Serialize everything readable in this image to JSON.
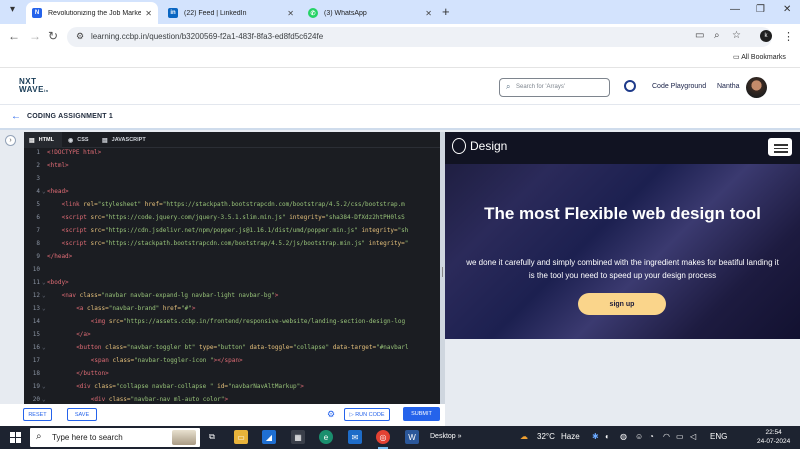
{
  "browser": {
    "tabs": [
      {
        "title": "Revolutionizing the Job Market",
        "favicon": "ccbp-icon",
        "color": "#2563eb",
        "active": true
      },
      {
        "title": "(22) Feed | LinkedIn",
        "favicon": "linkedin-icon",
        "color": "#0a66c2",
        "active": false
      },
      {
        "title": "(3) WhatsApp",
        "favicon": "whatsapp-icon",
        "color": "#25d366",
        "active": false
      }
    ],
    "url": "learning.ccbp.in/question/b3200569-f2a1-483f-8fa3-ed8fd5c624fe",
    "profile_initial": "k",
    "bookmarks_label": "All Bookmarks"
  },
  "site": {
    "logo_line1": "NXT",
    "logo_line2": "WAVE",
    "logo_suffix": "in",
    "search_placeholder": "Search for 'Arrays'",
    "playground_label": "Code Playground",
    "user_name": "Nantha",
    "assignment_title": "CODING ASSIGNMENT 1"
  },
  "editor": {
    "tabs": [
      {
        "label": "HTML",
        "icon": "html-file-icon",
        "active": true
      },
      {
        "label": "CSS",
        "icon": "css-file-icon",
        "active": false
      },
      {
        "label": "JAVASCRIPT",
        "icon": "js-file-icon",
        "active": false
      }
    ],
    "lines": [
      {
        "n": "1",
        "indent": 0,
        "fold": false,
        "segs": [
          [
            "tag",
            "<!DOCTYPE html>"
          ]
        ]
      },
      {
        "n": "2",
        "indent": 0,
        "fold": false,
        "segs": [
          [
            "tag",
            "<html>"
          ]
        ]
      },
      {
        "n": "3",
        "indent": 0,
        "fold": false,
        "segs": []
      },
      {
        "n": "4",
        "indent": 0,
        "fold": true,
        "segs": [
          [
            "tag",
            "<head>"
          ]
        ]
      },
      {
        "n": "5",
        "indent": 2,
        "fold": false,
        "segs": [
          [
            "tag",
            "<link "
          ],
          [
            "attr",
            "rel="
          ],
          [
            "str",
            "\"stylesheet\" "
          ],
          [
            "attr",
            "href="
          ],
          [
            "str",
            "\"https://stackpath.bootstrapcdn.com/bootstrap/4.5.2/css/bootstrap.m"
          ]
        ]
      },
      {
        "n": "6",
        "indent": 2,
        "fold": false,
        "segs": [
          [
            "tag",
            "<script "
          ],
          [
            "attr",
            "src="
          ],
          [
            "str",
            "\"https://code.jquery.com/jquery-3.5.1.slim.min.js\" "
          ],
          [
            "attr",
            "integrity="
          ],
          [
            "str",
            "\"sha384-DfXdz2htPH0lsS"
          ]
        ]
      },
      {
        "n": "7",
        "indent": 2,
        "fold": false,
        "segs": [
          [
            "tag",
            "<script "
          ],
          [
            "attr",
            "src="
          ],
          [
            "str",
            "\"https://cdn.jsdelivr.net/npm/popper.js@1.16.1/dist/umd/popper.min.js\" "
          ],
          [
            "attr",
            "integrity="
          ],
          [
            "str",
            "\"sh"
          ]
        ]
      },
      {
        "n": "8",
        "indent": 2,
        "fold": false,
        "segs": [
          [
            "tag",
            "<script "
          ],
          [
            "attr",
            "src="
          ],
          [
            "str",
            "\"https://stackpath.bootstrapcdn.com/bootstrap/4.5.2/js/bootstrap.min.js\" "
          ],
          [
            "attr",
            "integrity="
          ],
          [
            "str",
            "\""
          ]
        ]
      },
      {
        "n": "9",
        "indent": 0,
        "fold": false,
        "segs": [
          [
            "tag",
            "</head>"
          ]
        ]
      },
      {
        "n": "10",
        "indent": 0,
        "fold": false,
        "segs": []
      },
      {
        "n": "11",
        "indent": 0,
        "fold": true,
        "segs": [
          [
            "tag",
            "<body>"
          ]
        ]
      },
      {
        "n": "12",
        "indent": 2,
        "fold": true,
        "segs": [
          [
            "tag",
            "<nav "
          ],
          [
            "attr",
            "class="
          ],
          [
            "str",
            "\"navbar navbar-expand-lg navbar-light navbar-bg\""
          ],
          [
            "tag",
            ">"
          ]
        ]
      },
      {
        "n": "13",
        "indent": 4,
        "fold": true,
        "segs": [
          [
            "tag",
            "<a "
          ],
          [
            "attr",
            "class="
          ],
          [
            "str",
            "\"navbar-brand\" "
          ],
          [
            "attr",
            "href="
          ],
          [
            "str",
            "\"#\""
          ],
          [
            "tag",
            ">"
          ]
        ]
      },
      {
        "n": "14",
        "indent": 6,
        "fold": false,
        "segs": [
          [
            "tag",
            "<img "
          ],
          [
            "attr",
            "src="
          ],
          [
            "str",
            "\"https://assets.ccbp.in/frontend/responsive-website/landing-section-design-log"
          ]
        ]
      },
      {
        "n": "15",
        "indent": 4,
        "fold": false,
        "segs": [
          [
            "tag",
            "</a>"
          ]
        ]
      },
      {
        "n": "16",
        "indent": 4,
        "fold": true,
        "segs": [
          [
            "tag",
            "<button "
          ],
          [
            "attr",
            "class="
          ],
          [
            "str",
            "\"navbar-toggler bt\" "
          ],
          [
            "attr",
            "type="
          ],
          [
            "str",
            "\"button\" "
          ],
          [
            "attr",
            "data-toggle="
          ],
          [
            "str",
            "\"collapse\" "
          ],
          [
            "attr",
            "data-target="
          ],
          [
            "str",
            "\"#navbarl"
          ]
        ]
      },
      {
        "n": "17",
        "indent": 6,
        "fold": false,
        "segs": [
          [
            "tag",
            "<span "
          ],
          [
            "attr",
            "class="
          ],
          [
            "str",
            "\"navbar-toggler-icon \""
          ],
          [
            "tag",
            "></span>"
          ]
        ]
      },
      {
        "n": "18",
        "indent": 4,
        "fold": false,
        "segs": [
          [
            "tag",
            "</button>"
          ]
        ]
      },
      {
        "n": "19",
        "indent": 4,
        "fold": true,
        "segs": [
          [
            "tag",
            "<div "
          ],
          [
            "attr",
            "class="
          ],
          [
            "str",
            "\"collapse navbar-collapse \" "
          ],
          [
            "attr",
            "id="
          ],
          [
            "str",
            "\"navbarNavAltMarkup\""
          ],
          [
            "tag",
            ">"
          ]
        ]
      },
      {
        "n": "20",
        "indent": 6,
        "fold": true,
        "segs": [
          [
            "tag",
            "<div "
          ],
          [
            "attr",
            "class="
          ],
          [
            "str",
            "\"navbar-nav ml-auto color\""
          ],
          [
            "tag",
            ">"
          ]
        ]
      }
    ],
    "reset_label": "RESET",
    "save_label": "SAVE",
    "run_label": "RUN CODE",
    "submit_label": "SUBMIT"
  },
  "preview": {
    "brand": "Design",
    "heading": "The most Flexible web design tool",
    "paragraph": "we done it carefully and simply combined with the ingredient makes for beatiful landing it is the tool you need to speed up your design process",
    "cta": "sign up"
  },
  "taskbar": {
    "search_placeholder": "Type here to search",
    "desktop_label": "Desktop",
    "temperature": "32°C",
    "weather": "Haze",
    "lang": "ENG",
    "time": "22:54",
    "date": "24-07-2024"
  }
}
